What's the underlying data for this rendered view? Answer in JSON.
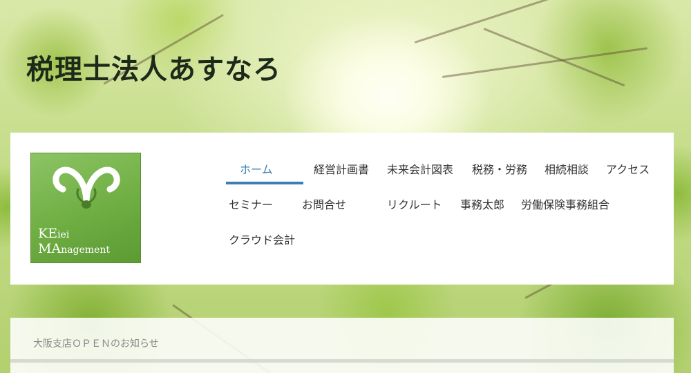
{
  "site": {
    "title": "税理士法人あすなろ"
  },
  "logo": {
    "line1_big": "KE",
    "line1_small": "iei",
    "line2_big": "MA",
    "line2_small": "nagement",
    "colors": {
      "dark": "#5c9a33",
      "light": "#8cc464"
    }
  },
  "nav": {
    "items": [
      {
        "label": "ホーム",
        "active": true
      },
      {
        "label": "経営計画書"
      },
      {
        "label": "未来会計図表"
      },
      {
        "label": "税務・労務"
      },
      {
        "label": "相続相談"
      },
      {
        "label": "アクセス"
      },
      {
        "label": "セミナー"
      },
      {
        "label": "お問合せ"
      },
      {
        "label": "リクルート"
      },
      {
        "label": "事務太郎"
      },
      {
        "label": "労働保険事務組合"
      },
      {
        "label": "クラウド会計"
      }
    ],
    "active_color": "#3d7fb2"
  },
  "content": {
    "news_title": "大阪支店ＯＰＥＮのお知らせ"
  }
}
